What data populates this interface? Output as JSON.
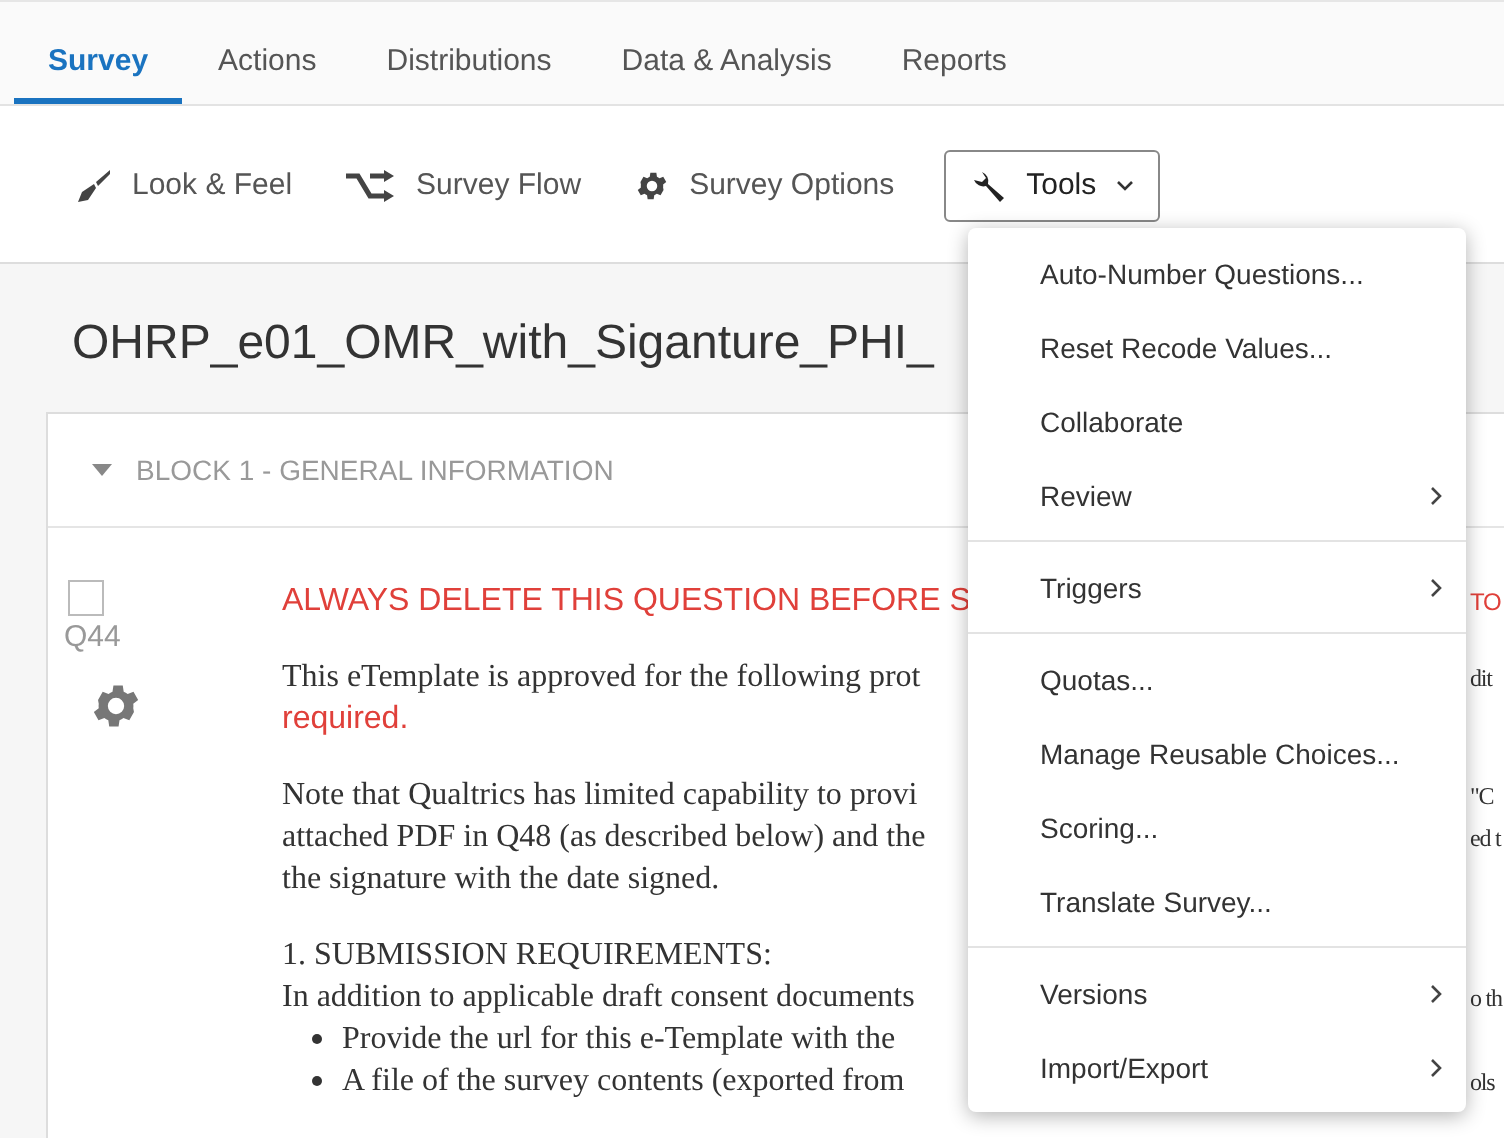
{
  "tabs": [
    {
      "label": "Survey",
      "selected": true
    },
    {
      "label": "Actions",
      "selected": false
    },
    {
      "label": "Distributions",
      "selected": false
    },
    {
      "label": "Data & Analysis",
      "selected": false
    },
    {
      "label": "Reports",
      "selected": false
    }
  ],
  "toolbar": [
    {
      "label": "Look & Feel",
      "kind": "brush",
      "pressed": false
    },
    {
      "label": "Survey Flow",
      "kind": "flow",
      "pressed": false
    },
    {
      "label": "Survey Options",
      "kind": "gear",
      "pressed": false
    },
    {
      "label": "Tools",
      "kind": "wrench",
      "pressed": true
    }
  ],
  "survey_title": "OHRP_e01_OMR_with_Siganture_PHI_",
  "block": {
    "title": "BLOCK 1 - GENERAL INFORMATION",
    "expanded": true
  },
  "question": {
    "number": "Q44",
    "checked": false,
    "paragraphs": [
      [
        {
          "kind": "alert",
          "text": "ALWAYS DELETE THIS QUESTION BEFORE S",
          "right": "TO"
        }
      ],
      [
        {
          "kind": "plain",
          "text": "This eTemplate is approved for the following prot",
          "right": "dit"
        },
        {
          "kind": "alert",
          "text": "required."
        }
      ],
      [
        {
          "kind": "plain",
          "text": "Note that Qualtrics has limited capability to provi",
          "right": "\"C"
        },
        {
          "kind": "plain",
          "text": "attached PDF in Q48 (as described below) and the",
          "right": "ed t"
        },
        {
          "kind": "plain",
          "text": "the signature with the date signed."
        }
      ],
      [
        {
          "kind": "plain",
          "text": "1. SUBMISSION REQUIREMENTS:"
        },
        {
          "kind": "plain",
          "text": "In addition to applicable draft consent documents",
          "right": "o th"
        },
        {
          "kind": "bullet",
          "text": "Provide the url for this e-Template with the"
        },
        {
          "kind": "bullet",
          "text": "A file of the survey contents (exported from",
          "right": "ols"
        }
      ]
    ]
  },
  "menu": [
    [
      {
        "label": "Auto-Number Questions...",
        "submenu": false
      },
      {
        "label": "Reset Recode Values...",
        "submenu": false
      },
      {
        "label": "Collaborate",
        "submenu": false
      },
      {
        "label": "Review",
        "submenu": true
      }
    ],
    [
      {
        "label": "Triggers",
        "submenu": true
      }
    ],
    [
      {
        "label": "Quotas...",
        "submenu": false
      },
      {
        "label": "Manage Reusable Choices...",
        "submenu": false
      },
      {
        "label": "Scoring...",
        "submenu": false
      },
      {
        "label": "Translate Survey...",
        "submenu": false
      }
    ],
    [
      {
        "label": "Versions",
        "submenu": true
      },
      {
        "label": "Import/Export",
        "submenu": true
      }
    ]
  ]
}
